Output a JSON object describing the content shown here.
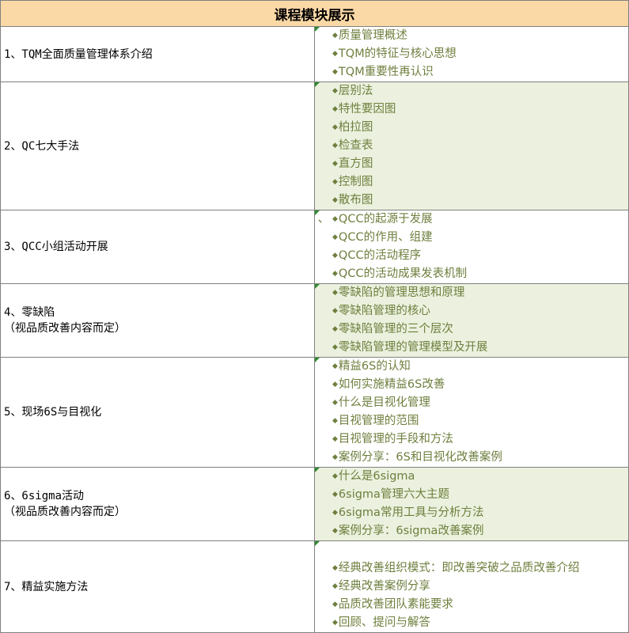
{
  "title": "课程模块展示",
  "bullet": "◆",
  "modules": [
    {
      "name": "1、TQM全面质量管理体系介绍",
      "note": "",
      "shaded": false,
      "top_pad": 0,
      "items": [
        "质量管理概述",
        "TQM的特征与核心思想",
        "TQM重要性再认识"
      ]
    },
    {
      "name": "2、QC七大手法",
      "note": "",
      "shaded": true,
      "top_pad": 0,
      "items": [
        "层别法",
        "特性要因图",
        "柏拉图",
        "检查表",
        "直方图",
        "控制图",
        "散布图"
      ]
    },
    {
      "name": "3、QCC小组活动开展",
      "note": "",
      "shaded": false,
      "top_pad": 0,
      "lead_mark": "、",
      "items": [
        "QCC的起源于发展",
        "QCC的作用、组建",
        "QCC的活动程序",
        "QCC的活动成果发表机制"
      ]
    },
    {
      "name": "4、零缺陷",
      "note": "（视品质改善内容而定）",
      "shaded": true,
      "top_pad": 0,
      "items": [
        "零缺陷的管理思想和原理",
        "零缺陷管理的核心",
        "零缺陷管理的三个层次",
        "零缺陷管理的管理模型及开展"
      ]
    },
    {
      "name": "5、现场6S与目视化",
      "note": "",
      "shaded": false,
      "top_pad": 0,
      "items": [
        "精益6S的认知",
        "如何实施精益6S改善",
        "什么是目视化管理",
        "目视管理的范围",
        "目视管理的手段和方法",
        "案例分享：6S和目视化改善案例"
      ]
    },
    {
      "name": "6、6sigma活动",
      "note": "（视品质改善内容而定）",
      "shaded": true,
      "top_pad": 0,
      "items": [
        "什么是6sigma",
        "6sigma管理六大主题",
        "6sigma常用工具与分析方法",
        "案例分享：6sigma改善案例"
      ]
    },
    {
      "name": "7、精益实施方法",
      "note": "",
      "shaded": false,
      "top_pad": 1,
      "items": [
        "经典改善组织模式：即改善突破之品质改善介绍",
        "经典改善案例分享",
        "品质改善团队素能要求",
        "回顾、提问与解答"
      ]
    }
  ]
}
